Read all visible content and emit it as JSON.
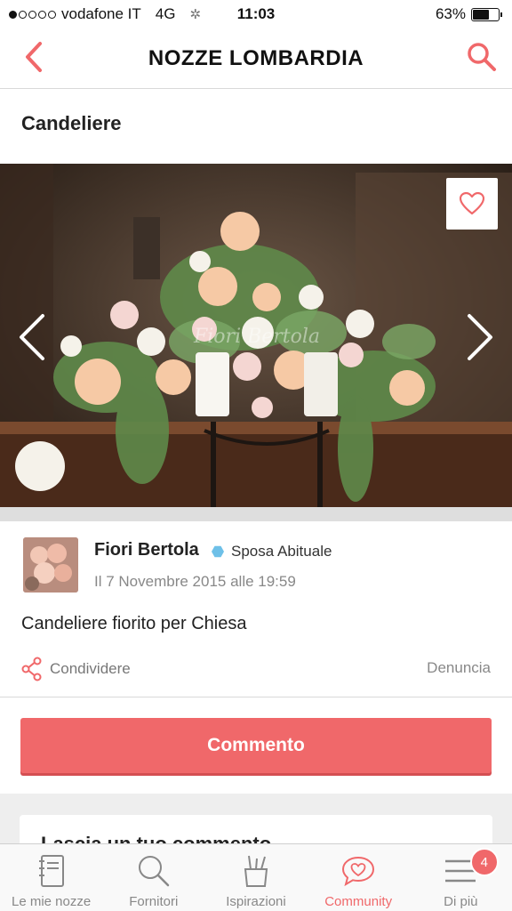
{
  "status_bar": {
    "carrier": "vodafone IT",
    "network": "4G",
    "time": "11:03",
    "battery": "63%",
    "battery_level": 0.63
  },
  "nav": {
    "title": "NOZZE LOMBARDIA",
    "back_icon": "chevron-left-icon",
    "search_icon": "search-icon"
  },
  "post": {
    "title": "Candeliere",
    "photo_watermark": "Fiori Bertola",
    "author": "Fiori Bertola",
    "badge": "Sposa Abituale",
    "date": "Il 7 Novembre 2015 alle 19:59",
    "description": "Candeliere fiorito per Chiesa",
    "share_label": "Condividere",
    "report_label": "Denuncia",
    "comment_button": "Commento",
    "comment_heading": "Lascia un tuo commento"
  },
  "tabs": [
    {
      "label": "Le mie nozze",
      "icon": "notebook-icon"
    },
    {
      "label": "Fornitori",
      "icon": "search-icon"
    },
    {
      "label": "Ispirazioni",
      "icon": "pencil-cup-icon"
    },
    {
      "label": "Community",
      "icon": "heart-bubble-icon",
      "active": true
    },
    {
      "label": "Di più",
      "icon": "menu-icon",
      "badge": "4"
    }
  ],
  "colors": {
    "accent": "#f0686a",
    "badge_blue": "#6ec0e8"
  }
}
